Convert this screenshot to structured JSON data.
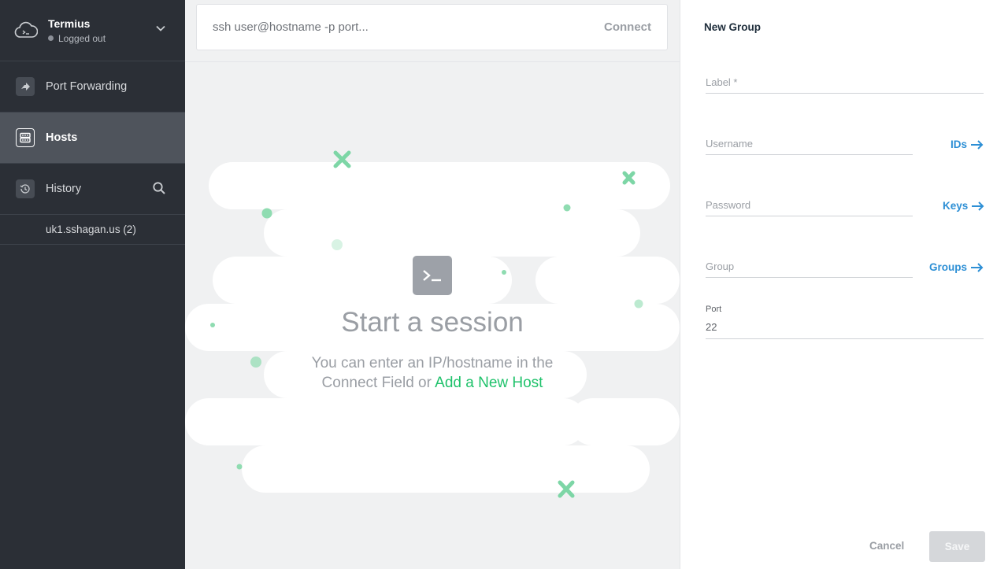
{
  "account": {
    "name": "Termius",
    "status": "Logged out"
  },
  "nav": [
    {
      "label": "Port Forwarding",
      "icon": "port-forwarding-icon"
    },
    {
      "label": "Hosts",
      "icon": "hosts-icon"
    },
    {
      "label": "History",
      "icon": "history-icon"
    }
  ],
  "history_entries": [
    "uk1.sshagan.us (2)"
  ],
  "connect_bar": {
    "placeholder": "ssh user@hostname -p port...",
    "connect_label": "Connect"
  },
  "empty_state": {
    "title": "Start a session",
    "desc_line1": "You can enter an IP/hostname in the",
    "desc_line2": "Connect Field or ",
    "link": "Add a New Host"
  },
  "panel": {
    "title": "New Group",
    "label_placeholder": "Label *",
    "username_placeholder": "Username",
    "ids_link": "IDs",
    "password_placeholder": "Password",
    "keys_link": "Keys",
    "group_placeholder": "Group",
    "groups_link": "Groups",
    "port_label": "Port",
    "port_value": "22",
    "cancel_label": "Cancel",
    "save_label": "Save"
  },
  "colors": {
    "sidebar_bg": "#2b2f36",
    "active_nav_bg": "#4f545c",
    "accent_green": "#1fc26b",
    "link_blue": "#2d8fd5"
  }
}
